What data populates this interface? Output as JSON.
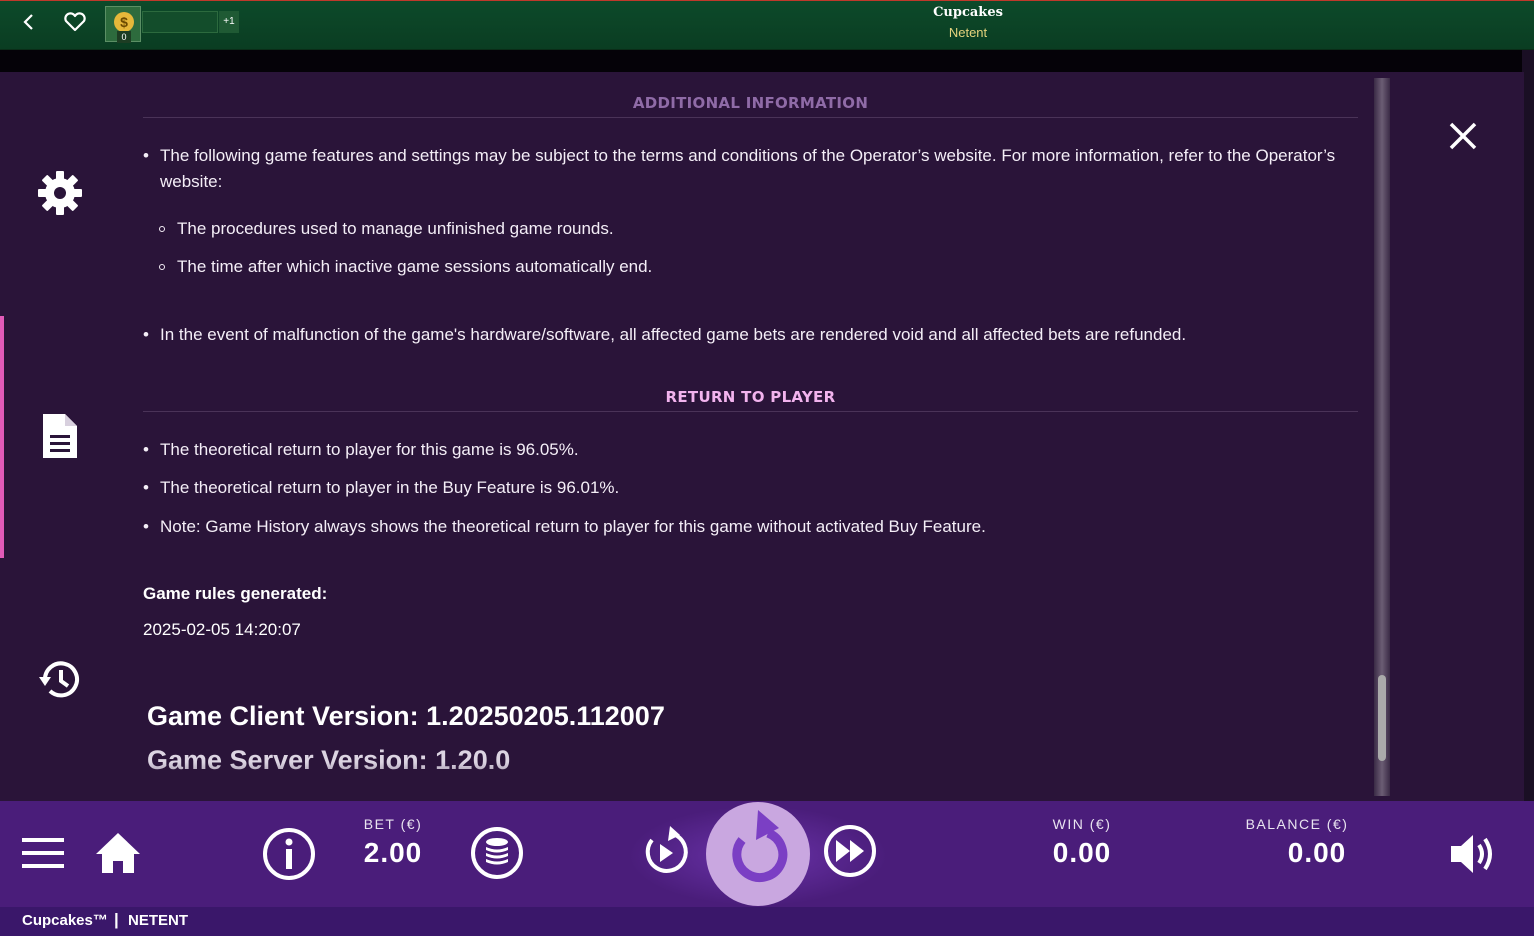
{
  "topbar": {
    "coin_value": "0",
    "plus_label": "+1",
    "game_title": "Cupcakes",
    "provider": "Netent"
  },
  "sidebar": {
    "items": [
      {
        "icon": "gear-icon"
      },
      {
        "icon": "document-icon"
      },
      {
        "icon": "history-icon"
      }
    ]
  },
  "content": {
    "additional_title": "ADDITIONAL INFORMATION",
    "additional_bullet_1": "The following game features and settings may be subject to the terms and conditions of the Operator’s website. For more information, refer to the Operator’s website:",
    "additional_sub_1": "The procedures used to manage unfinished game rounds.",
    "additional_sub_2": "The time after which inactive game sessions automatically end.",
    "additional_bullet_2": "In the event of malfunction of the game's hardware/software, all affected game bets are rendered void and all affected bets are refunded.",
    "rtp_title": "RETURN TO PLAYER",
    "rtp_bullet_1": "The theoretical return to player for this game is 96.05%.",
    "rtp_bullet_2": "The theoretical return to player in the Buy Feature is 96.01%.",
    "rtp_bullet_3": "Note: Game History always shows the theoretical return to player for this game without activated Buy Feature.",
    "rules_generated_label": "Game rules generated:",
    "rules_generated_date": "2025-02-05 14:20:07",
    "client_version": "Game Client Version: 1.20250205.112007",
    "server_version": "Game Server Version: 1.20.0"
  },
  "bottom": {
    "bet_label": "BET (€)",
    "bet_value": "2.00",
    "win_label": "WIN (€)",
    "win_value": "0.00",
    "balance_label": "BALANCE (€)",
    "balance_value": "0.00"
  },
  "footer": {
    "brand": "Cupcakes™",
    "separator": "|",
    "provider": "NETENT"
  },
  "colors": {
    "panel_bg": "#2a1439",
    "bottom_bar": "#4a1d7a",
    "top_bar": "#0d4a2a",
    "section_title": "#f2b3ee",
    "spin_button": "#c9a7e0"
  }
}
